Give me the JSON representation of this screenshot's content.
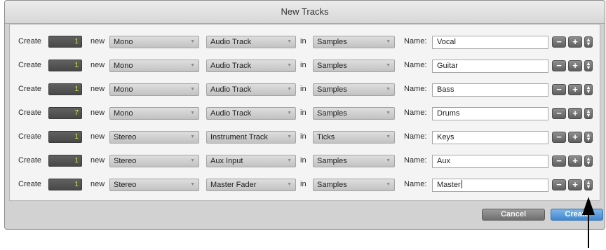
{
  "dialog": {
    "title": "New Tracks"
  },
  "labels": {
    "create": "Create",
    "new": "new",
    "in": "in",
    "name": "Name:"
  },
  "rows": [
    {
      "count": "1",
      "format": "Mono",
      "type": "Audio Track",
      "timebase": "Samples",
      "name": "Vocal"
    },
    {
      "count": "1",
      "format": "Mono",
      "type": "Audio Track",
      "timebase": "Samples",
      "name": "Guitar"
    },
    {
      "count": "1",
      "format": "Mono",
      "type": "Audio Track",
      "timebase": "Samples",
      "name": "Bass"
    },
    {
      "count": "7",
      "format": "Mono",
      "type": "Audio Track",
      "timebase": "Samples",
      "name": "Drums"
    },
    {
      "count": "1",
      "format": "Stereo",
      "type": "Instrument Track",
      "timebase": "Ticks",
      "name": "Keys"
    },
    {
      "count": "1",
      "format": "Stereo",
      "type": "Aux Input",
      "timebase": "Samples",
      "name": "Aux"
    },
    {
      "count": "1",
      "format": "Stereo",
      "type": "Master Fader",
      "timebase": "Samples",
      "name": "Master"
    }
  ],
  "buttons": {
    "cancel": "Cancel",
    "create": "Create"
  },
  "icons": {
    "remove_row": "minus-icon",
    "add_row": "plus-icon",
    "move_row": "drag-handle-icon",
    "pointer": "arrow-up-icon"
  },
  "colors": {
    "count_text": "#c7ee3e",
    "create_button": "#3f86cf",
    "cancel_button": "#6f6f6f"
  }
}
